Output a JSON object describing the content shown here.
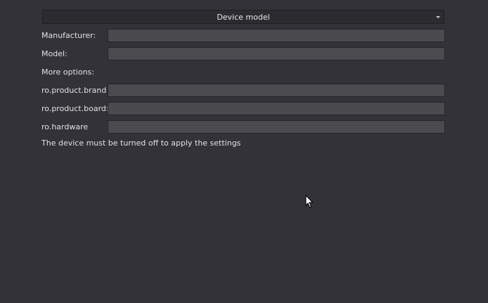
{
  "dropdown": {
    "selected": "Device model"
  },
  "fields": {
    "manufacturer": {
      "label": "Manufacturer:",
      "value": ""
    },
    "model": {
      "label": "Model:",
      "value": ""
    },
    "more_options_label": "More options:",
    "brand": {
      "label": "ro.product.brand",
      "value": ""
    },
    "board": {
      "label": "ro.product.board:",
      "value": ""
    },
    "hardware": {
      "label": "ro.hardware",
      "value": ""
    }
  },
  "note": "The device must be turned off to apply the settings",
  "icons": {
    "dropdown_arrow": "chevron-down-icon",
    "cursor": "mouse-pointer-icon"
  },
  "colors": {
    "background": "#333238",
    "field_background": "#4a4a4f",
    "text": "#e2e2e2"
  }
}
